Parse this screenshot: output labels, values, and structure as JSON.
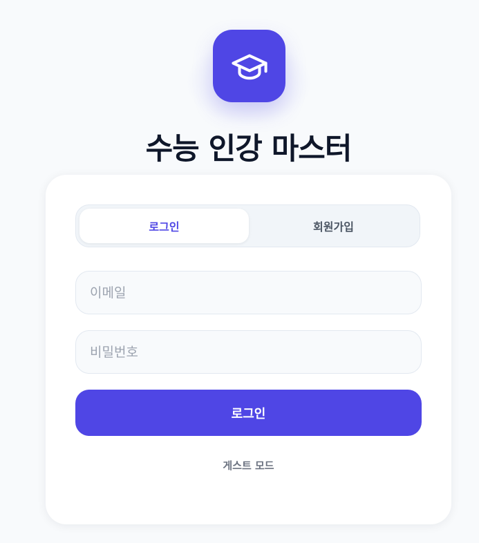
{
  "app": {
    "title": "수능 인강 마스터",
    "logo_icon": "graduation-cap-icon",
    "accent_color": "#4f46e5"
  },
  "auth_tabs": {
    "login_label": "로그인",
    "signup_label": "회원가입",
    "active_tab": "login"
  },
  "form": {
    "email_placeholder": "이메일",
    "email_value": "",
    "password_placeholder": "비밀번호",
    "password_value": "",
    "submit_label": "로그인"
  },
  "guest": {
    "label": "게스트 모드"
  }
}
